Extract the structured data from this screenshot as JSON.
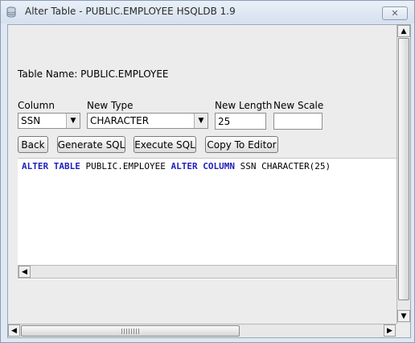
{
  "window": {
    "title": "Alter Table - PUBLIC.EMPLOYEE HSQLDB 1.9",
    "close_icon": "close-icon"
  },
  "form": {
    "table_name_label": "Table Name: PUBLIC.EMPLOYEE",
    "column_label": "Column",
    "column_value": "SSN",
    "new_type_label": "New Type",
    "new_type_value": "CHARACTER",
    "new_length_label": "New Length",
    "new_length_value": "25",
    "new_scale_label": "New Scale",
    "new_scale_value": ""
  },
  "buttons": {
    "back": "Back",
    "generate_sql": "Generate SQL",
    "execute_sql": "Execute SQL",
    "copy_to_editor": "Copy To Editor"
  },
  "sql": {
    "kw1": "ALTER",
    "kw2": "TABLE",
    "table": "PUBLIC.EMPLOYEE",
    "kw3": "ALTER",
    "kw4": "COLUMN",
    "rest": "SSN CHARACTER(25)"
  },
  "colors": {
    "keyword": "#1f1fbf"
  }
}
